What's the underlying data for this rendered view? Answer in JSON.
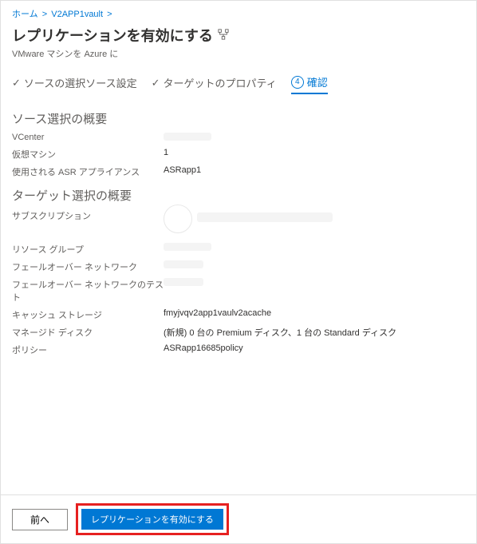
{
  "breadcrumb": {
    "home": "ホーム",
    "vault": "V2APP1vault"
  },
  "title": "レプリケーションを有効にする",
  "subtitle": "VMware マシンを Azure に",
  "steps": {
    "source_select": "ソースの選択",
    "source_settings": "ソース設定",
    "target_props": "ターゲットのプロパティ",
    "confirm_num": "4",
    "confirm": "確認"
  },
  "source_summary": {
    "heading": "ソース選択の概要",
    "vcenter_label": "VCenter",
    "vm_label": "仮想マシン",
    "vm_value": "1",
    "appliance_label": "使用される ASR アプライアンス",
    "appliance_value": "ASRapp1"
  },
  "target_summary": {
    "heading": "ターゲット選択の概要",
    "subscription_label": "サブスクリプション",
    "rg_label": "リソース グループ",
    "failover_net_label": "フェールオーバー ネットワーク",
    "failover_net_test_label": "フェールオーバー ネットワークのテスト",
    "cache_label": "キャッシュ ストレージ",
    "cache_value": "fmyjvqv2app1vaulv2acache",
    "managed_disk_label": "マネージド ディスク",
    "managed_disk_value": "(新規) 0 台の Premium ディスク、1 台の Standard ディスク",
    "policy_label": "ポリシー",
    "policy_value": "ASRapp16685policy"
  },
  "footer": {
    "prev": "前へ",
    "enable": "レプリケーションを有効にする"
  }
}
